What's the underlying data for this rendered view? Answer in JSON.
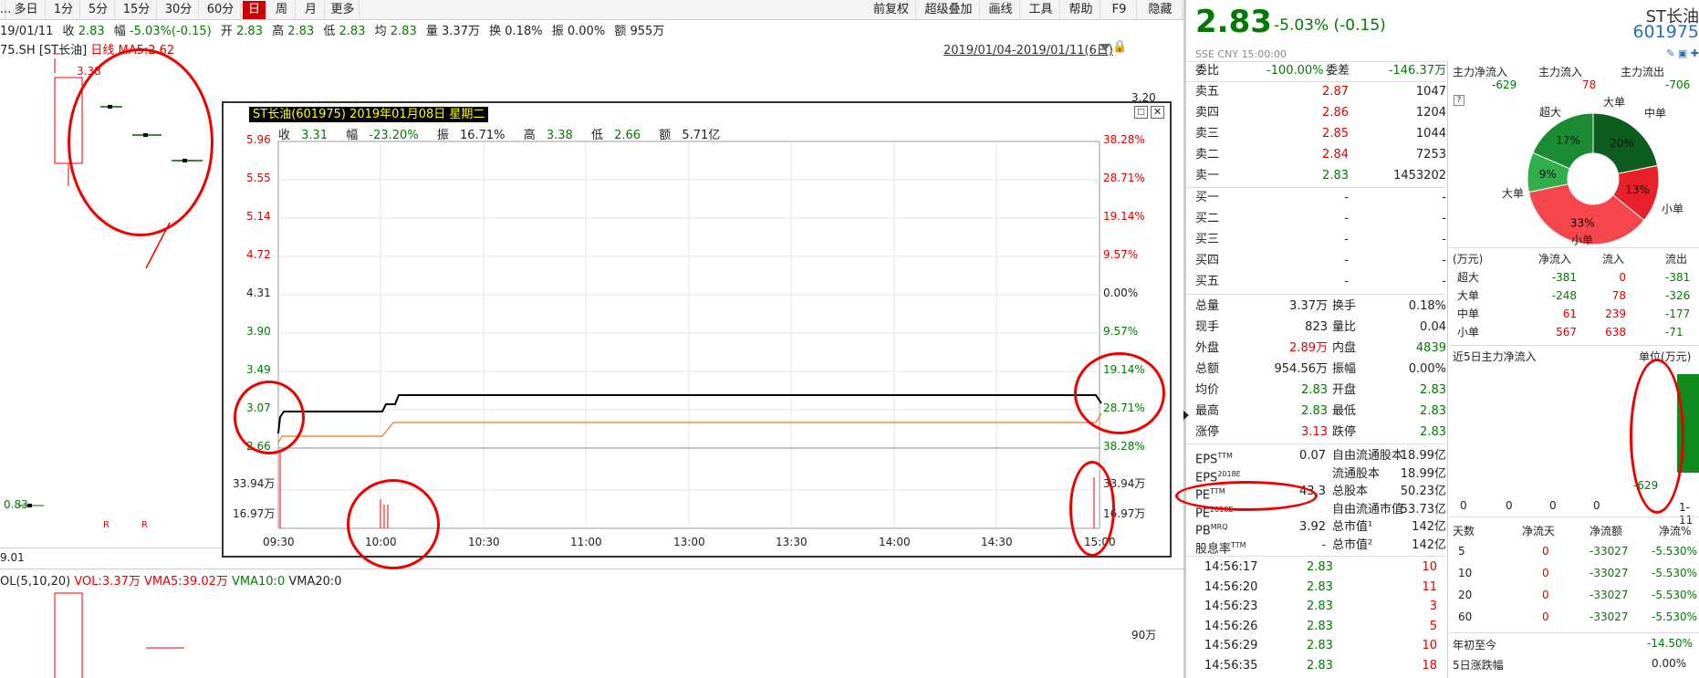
{
  "toolbar": {
    "periods": [
      "...",
      "多日",
      "1分",
      "5分",
      "15分",
      "30分",
      "60分",
      "日",
      "周",
      "月",
      "更多"
    ],
    "active_period": "日",
    "right_buttons": [
      "前复权",
      "超级叠加",
      "画线",
      "工具",
      "帮助",
      "F9",
      "隐藏"
    ]
  },
  "infobar": {
    "date": "19/01/11",
    "close_label": "收",
    "close": "2.83",
    "change_label": "幅",
    "change": "-5.03%(-0.15)",
    "open_label": "开",
    "open": "2.83",
    "high_label": "高",
    "high": "2.83",
    "low_label": "低",
    "low": "2.83",
    "avg_label": "均",
    "avg": "2.83",
    "vol_label": "量",
    "vol": "3.37万",
    "turnover_label": "换",
    "turnover": "0.18%",
    "amp_label": "振",
    "amp": "0.00%",
    "amount_label": "额",
    "amount": "955万"
  },
  "kline": {
    "code": "75.SH",
    "name": "[ST长油]",
    "period": "日线",
    "ma": "MA5:2.62",
    "peak_label": "3.38",
    "range": "2019/01/04-2019/01/11(6日)",
    "price_3_20": "3.20",
    "low_label": "0.83",
    "date_bottom": "9.01",
    "r1": "R",
    "r2": "R",
    "vol_indicator": "OL(5,10,20)",
    "vol": "VOL:3.37万",
    "vma5": "VMA5:39.02万",
    "vma10": "VMA10:0",
    "vma20": "VMA20:0",
    "vol_axis": "90万"
  },
  "popup": {
    "title": "ST长油(601975) 2019年01月08日 星期二",
    "close_label": "收",
    "close": "3.31",
    "change_label": "幅",
    "change": "-23.20%",
    "amp_label": "振",
    "amp": "16.71%",
    "high_label": "高",
    "high": "3.38",
    "low_label": "低",
    "low": "2.66",
    "amount_label": "额",
    "amount": "5.71亿",
    "y_left": [
      "5.96",
      "5.55",
      "5.14",
      "4.72",
      "4.31",
      "3.90",
      "3.49",
      "3.07",
      "2.66"
    ],
    "y_right": [
      "38.28%",
      "28.71%",
      "19.14%",
      "9.57%",
      "0.00%",
      "9.57%",
      "19.14%",
      "28.71%",
      "38.28%"
    ],
    "vol_left": [
      "33.94万",
      "16.97万"
    ],
    "vol_right": [
      "33.94万",
      "16.97万"
    ],
    "times": [
      "09:30",
      "10:00",
      "10:30",
      "11:00",
      "13:00",
      "13:30",
      "14:00",
      "14:30",
      "15:00"
    ]
  },
  "quote": {
    "price": "2.83",
    "change": "-5.03% (-0.15)",
    "name": "ST长油",
    "code": "601975",
    "exchange": "SSE",
    "currency": "CNY",
    "time": "15:00:00",
    "weibi_label": "委比",
    "weibi": "-100.00%",
    "weicha_label": "委差",
    "weicha": "-146.37万",
    "asks": [
      {
        "label": "卖五",
        "price": "2.87",
        "vol": "1047"
      },
      {
        "label": "卖四",
        "price": "2.86",
        "vol": "1204"
      },
      {
        "label": "卖三",
        "price": "2.85",
        "vol": "1044"
      },
      {
        "label": "卖二",
        "price": "2.84",
        "vol": "7253"
      },
      {
        "label": "卖一",
        "price": "2.83",
        "vol": "1453202"
      }
    ],
    "bids": [
      {
        "label": "买一",
        "price": "-",
        "vol": "-"
      },
      {
        "label": "买二",
        "price": "-",
        "vol": "-"
      },
      {
        "label": "买三",
        "price": "-",
        "vol": "-"
      },
      {
        "label": "买四",
        "price": "-",
        "vol": "-"
      },
      {
        "label": "买五",
        "price": "-",
        "vol": "-"
      }
    ],
    "stats": [
      {
        "l1": "总量",
        "v1": "3.37万",
        "c1": "blk",
        "l2": "换手",
        "v2": "0.18%",
        "c2": "blk"
      },
      {
        "l1": "现手",
        "v1": "823",
        "c1": "blk",
        "l2": "量比",
        "v2": "0.04",
        "c2": "blk"
      },
      {
        "l1": "外盘",
        "v1": "2.89万",
        "c1": "red",
        "l2": "内盘",
        "v2": "4839",
        "c2": "grn"
      },
      {
        "l1": "总额",
        "v1": "954.56万",
        "c1": "blk",
        "l2": "振幅",
        "v2": "0.00%",
        "c2": "blk"
      },
      {
        "l1": "均价",
        "v1": "2.83",
        "c1": "grn",
        "l2": "开盘",
        "v2": "2.83",
        "c2": "grn"
      },
      {
        "l1": "最高",
        "v1": "2.83",
        "c1": "grn",
        "l2": "最低",
        "v2": "2.83",
        "c2": "grn"
      },
      {
        "l1": "涨停",
        "v1": "3.13",
        "c1": "red",
        "l2": "跌停",
        "v2": "2.83",
        "c2": "grn"
      }
    ],
    "fin": [
      {
        "l1": "EPS",
        "s1": "TTM",
        "v1": "0.07",
        "l2": "自由流通股本",
        "v2": "18.99亿"
      },
      {
        "l1": "EPS",
        "s1": "2018E",
        "v1": "",
        "l2": "流通股本",
        "v2": "18.99亿"
      },
      {
        "l1": "PE",
        "s1": "TTM",
        "v1": "43.3",
        "l2": "总股本",
        "v2": "50.23亿"
      },
      {
        "l1": "PE",
        "s1": "2018E",
        "v1": "",
        "l2": "自由流通市值",
        "v2": "53.73亿"
      },
      {
        "l1": "PB",
        "s1": "MRQ",
        "v1": "3.92",
        "l2": "总市值¹",
        "v2": "142亿"
      },
      {
        "l1": "股息率",
        "s1": "TTM",
        "v1": "-",
        "l2": "总市值²",
        "v2": "142亿"
      }
    ],
    "ticks": [
      {
        "t": "14:56:17",
        "p": "2.83",
        "v": "10"
      },
      {
        "t": "14:56:20",
        "p": "2.83",
        "v": "11"
      },
      {
        "t": "14:56:23",
        "p": "2.83",
        "v": "3"
      },
      {
        "t": "14:56:26",
        "p": "2.83",
        "v": "5"
      },
      {
        "t": "14:56:29",
        "p": "2.83",
        "v": "10"
      },
      {
        "t": "14:56:35",
        "p": "2.83",
        "v": "18"
      }
    ]
  },
  "flow": {
    "headers": [
      "主力净流入",
      "主力流入",
      "主力流出"
    ],
    "values": [
      "-629",
      "78",
      "-706"
    ],
    "pie_labels": {
      "super": "超大",
      "big_top": "大单",
      "mid": "中单",
      "big_left": "大单",
      "small_right": "小单",
      "small_bottom": "小单"
    },
    "pie_pcts": [
      "20%",
      "13%",
      "33%",
      "9%",
      "17%"
    ],
    "pie_values": [
      20,
      13,
      33,
      9,
      17
    ],
    "pie_colors": [
      "#0d5e1e",
      "#e8202a",
      "#f4464c",
      "#2fae4a",
      "#1a8c34"
    ],
    "question": "?",
    "table_headers": [
      "(万元)",
      "净流入",
      "流入",
      "流出"
    ],
    "table": [
      {
        "l": "超大",
        "n": "-381",
        "i": "0",
        "o": "-381"
      },
      {
        "l": "大单",
        "n": "-248",
        "i": "78",
        "o": "-326"
      },
      {
        "l": "中单",
        "n": "61",
        "i": "239",
        "o": "-177"
      },
      {
        "l": "小单",
        "n": "567",
        "i": "638",
        "o": "-71"
      }
    ],
    "five_day_title": "近5日主力净流入",
    "unit": "单位(万元)",
    "five_day_values": [
      "0",
      "0",
      "0",
      "0",
      "-629"
    ],
    "five_day_date": "1-11",
    "period_headers": [
      "天数",
      "净流天",
      "净流额",
      "净流%"
    ],
    "periods": [
      {
        "d": "5",
        "n": "0",
        "a": "-33027",
        "p": "-5.530%"
      },
      {
        "d": "10",
        "n": "0",
        "a": "-33027",
        "p": "-5.530%"
      },
      {
        "d": "20",
        "n": "0",
        "a": "-33027",
        "p": "-5.530%"
      },
      {
        "d": "60",
        "n": "0",
        "a": "-33027",
        "p": "-5.530%"
      }
    ],
    "ytd_label": "年初至今",
    "ytd": "-14.50%",
    "fiveday_fall_label": "5日涨跌幅",
    "fiveday_fall": "0.00%"
  }
}
